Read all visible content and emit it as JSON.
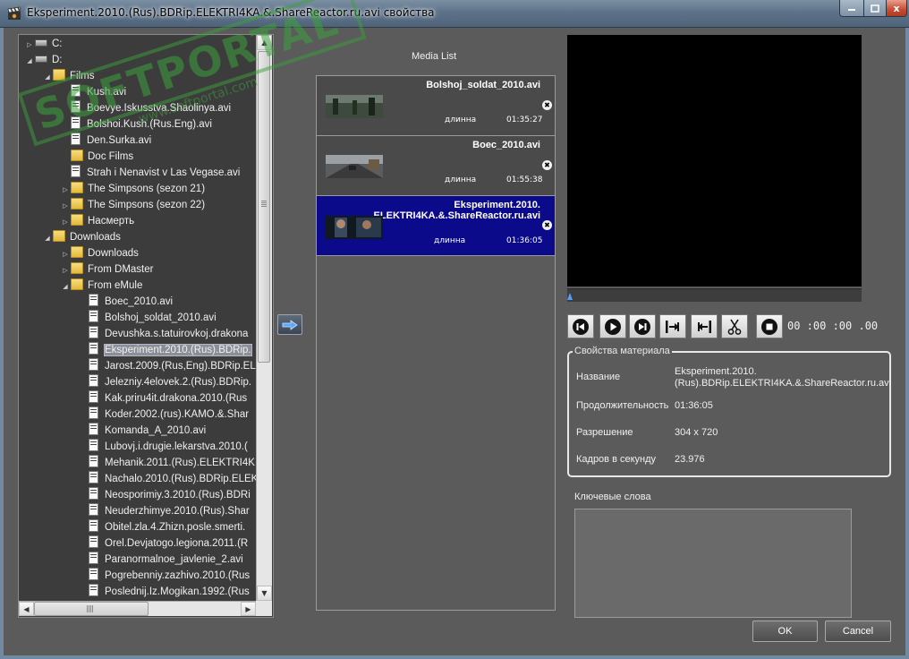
{
  "window": {
    "title": "Eksperiment.2010.(Rus).BDRip.ELEKTRI4KA.&.ShareReactor.ru.avi свойства",
    "app_icon": "clapperboard-icon",
    "minimize": "minimize-icon",
    "maximize": "maximize-icon",
    "close_glyph": "x"
  },
  "tree": {
    "rows": [
      {
        "label": "C:",
        "icon": "network-drive-icon",
        "indent": 0,
        "expander": "▷"
      },
      {
        "label": "D:",
        "icon": "drive-icon",
        "indent": 0,
        "expander": "◢"
      },
      {
        "label": "Films",
        "icon": "folder-icon",
        "indent": 1,
        "expander": "◢"
      },
      {
        "label": "Kush.avi",
        "icon": "file-icon",
        "indent": 2,
        "expander": ""
      },
      {
        "label": "Boevye.Iskusstva.Shaolinya.avi",
        "icon": "file-icon",
        "indent": 2,
        "expander": ""
      },
      {
        "label": "Bolshoi.Kush.(Rus.Eng).avi",
        "icon": "file-icon",
        "indent": 2,
        "expander": ""
      },
      {
        "label": "Den.Surka.avi",
        "icon": "file-icon",
        "indent": 2,
        "expander": ""
      },
      {
        "label": "Doc Films",
        "icon": "folder-icon",
        "indent": 2,
        "expander": ""
      },
      {
        "label": "Strah i Nenavist v Las Vegase.avi",
        "icon": "file-icon",
        "indent": 2,
        "expander": ""
      },
      {
        "label": "The Simpsons (sezon 21)",
        "icon": "folder-icon",
        "indent": 2,
        "expander": "▷"
      },
      {
        "label": "The Simpsons (sezon 22)",
        "icon": "folder-icon",
        "indent": 2,
        "expander": "▷"
      },
      {
        "label": "Насмерть",
        "icon": "folder-icon",
        "indent": 2,
        "expander": "▷"
      },
      {
        "label": "Downloads",
        "icon": "folder-icon",
        "indent": 1,
        "expander": "◢"
      },
      {
        "label": "Downloads",
        "icon": "folder-icon",
        "indent": 2,
        "expander": "▷"
      },
      {
        "label": "From DMaster",
        "icon": "folder-icon",
        "indent": 2,
        "expander": "▷"
      },
      {
        "label": "From eMule",
        "icon": "folder-icon",
        "indent": 2,
        "expander": "◢"
      },
      {
        "label": "Boec_2010.avi",
        "icon": "file-icon",
        "indent": 3,
        "expander": ""
      },
      {
        "label": "Bolshoj_soldat_2010.avi",
        "icon": "file-icon",
        "indent": 3,
        "expander": ""
      },
      {
        "label": "Devushka.s.tatuirovkoj.drakona",
        "icon": "file-icon",
        "indent": 3,
        "expander": ""
      },
      {
        "label": "Eksperiment.2010.(Rus).BDRip.",
        "icon": "file-icon",
        "indent": 3,
        "expander": "",
        "selected": true
      },
      {
        "label": "Jarost.2009.(Rus,Eng).BDRip.ELE",
        "icon": "file-icon",
        "indent": 3,
        "expander": ""
      },
      {
        "label": "Jelezniy.4elovek.2.(Rus).BDRip.",
        "icon": "file-icon",
        "indent": 3,
        "expander": ""
      },
      {
        "label": "Kak.priru4it.drakona.2010.(Rus",
        "icon": "file-icon",
        "indent": 3,
        "expander": ""
      },
      {
        "label": "Koder.2002.(rus).KAMO.&.Shar",
        "icon": "file-icon",
        "indent": 3,
        "expander": ""
      },
      {
        "label": "Komanda_A_2010.avi",
        "icon": "file-icon",
        "indent": 3,
        "expander": ""
      },
      {
        "label": "Lubovj.i.drugie.lekarstva.2010.(",
        "icon": "file-icon",
        "indent": 3,
        "expander": ""
      },
      {
        "label": "Mehanik.2011.(Rus).ELEKTRI4K",
        "icon": "file-icon",
        "indent": 3,
        "expander": ""
      },
      {
        "label": "Nachalo.2010.(Rus).BDRip.ELEK",
        "icon": "file-icon",
        "indent": 3,
        "expander": ""
      },
      {
        "label": "Neosporimiy.3.2010.(Rus).BDRi",
        "icon": "file-icon",
        "indent": 3,
        "expander": ""
      },
      {
        "label": "Neuderzhimye.2010.(Rus).Shar",
        "icon": "file-icon",
        "indent": 3,
        "expander": ""
      },
      {
        "label": "Obitel.zla.4.Zhizn.posle.smerti.",
        "icon": "file-icon",
        "indent": 3,
        "expander": ""
      },
      {
        "label": "Orel.Devjatogo.legiona.2011.(R",
        "icon": "file-icon",
        "indent": 3,
        "expander": ""
      },
      {
        "label": "Paranormalnoe_javlenie_2.avi",
        "icon": "file-icon",
        "indent": 3,
        "expander": ""
      },
      {
        "label": "Pogrebenniy.zazhivo.2010.(Rus",
        "icon": "file-icon",
        "indent": 3,
        "expander": ""
      },
      {
        "label": "Poslednij.Iz.Mogikan.1992.(Rus",
        "icon": "file-icon",
        "indent": 3,
        "expander": ""
      }
    ]
  },
  "watermark": {
    "big": "SOFTPORTAL",
    "small": "www.softportal.com",
    "tm": "™"
  },
  "add_button_icon": "arrow-right-icon",
  "media_list": {
    "title": "Media List",
    "items": [
      {
        "name": "Bolshoj_soldat_2010.avi",
        "duration_label": "длинна",
        "duration": "01:35:27",
        "selected": false
      },
      {
        "name": "Boec_2010.avi",
        "duration_label": "длинна",
        "duration": "01:55:38",
        "selected": false
      },
      {
        "name": "Eksperiment.2010.\nELEKTRI4KA.&.ShareReactor.ru.avi",
        "duration_label": "длинна",
        "duration": "01:36:05",
        "selected": true
      }
    ],
    "remove_glyph": "✖"
  },
  "player": {
    "buttons": [
      "prev-icon",
      "play-icon",
      "next-icon",
      "mark-in-icon",
      "mark-out-icon",
      "scissors-icon",
      "stop-icon"
    ],
    "timecode": "00 :00 :00 .00",
    "seek_position": 0.0
  },
  "properties": {
    "legend": "Свойства материала",
    "rows": [
      {
        "label": "Название",
        "value": "Eksperiment.2010.\n(Rus).BDRip.ELEKTRI4KA.&.ShareReactor.ru.avi"
      },
      {
        "label": "Продолжительность",
        "value": "01:36:05"
      },
      {
        "label": "Разрешение",
        "value": "304 x 720"
      },
      {
        "label": "Кадров в секунду",
        "value": "23.976"
      }
    ]
  },
  "keywords": {
    "label": "Ключевые слова",
    "value": ""
  },
  "buttons": {
    "ok": "OK",
    "cancel": "Cancel"
  }
}
